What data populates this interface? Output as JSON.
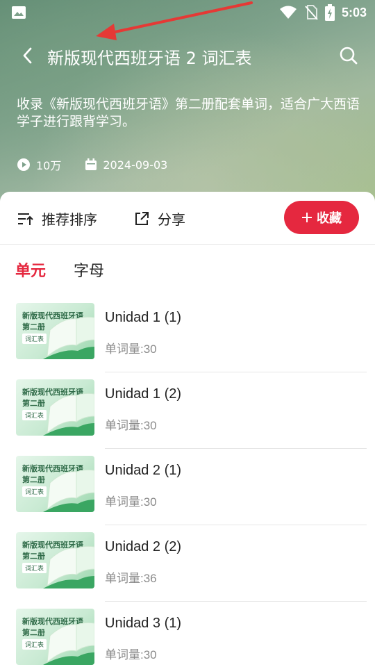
{
  "status_bar": {
    "time": "5:03",
    "icons": [
      "image-icon",
      "wifi-icon",
      "no-sim-icon",
      "battery-charging-icon"
    ]
  },
  "header": {
    "title": "新版现代西班牙语 2 词汇表",
    "description": "收录《新版现代西班牙语》第二册配套单词，适合广大西语学子进行跟背学习。",
    "plays": "10万",
    "date": "2024-09-03"
  },
  "actions": {
    "sort_label": "推荐排序",
    "share_label": "分享",
    "favorite_label": "收藏"
  },
  "tabs": [
    {
      "label": "单元",
      "active": true
    },
    {
      "label": "字母",
      "active": false
    }
  ],
  "thumbnail": {
    "line1": "新版现代西班牙语",
    "line2": "第二册",
    "tag": "词汇表"
  },
  "items": [
    {
      "title": "Unidad 1 (1)",
      "count": "单词量:30"
    },
    {
      "title": "Unidad 1 (2)",
      "count": "单词量:30"
    },
    {
      "title": "Unidad 2 (1)",
      "count": "单词量:30"
    },
    {
      "title": "Unidad 2 (2)",
      "count": "单词量:36"
    },
    {
      "title": "Unidad 3 (1)",
      "count": "单词量:30"
    }
  ],
  "colors": {
    "accent": "#e5283f",
    "annotation_arrow": "#e53935"
  }
}
